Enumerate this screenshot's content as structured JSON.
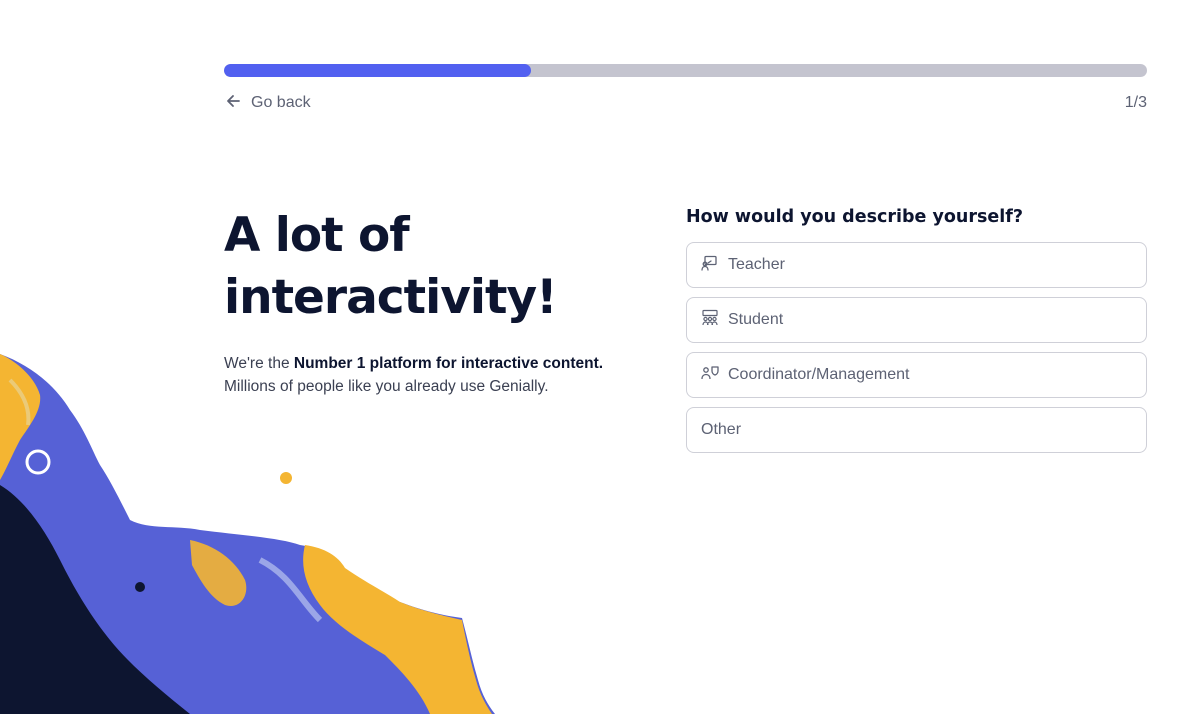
{
  "progress": {
    "fraction": 0.333,
    "step_text": "1/3"
  },
  "nav": {
    "go_back_label": "Go back",
    "back_icon": "arrow-left-icon"
  },
  "hero": {
    "title_line1": "A lot of",
    "title_line2": "interactivity!",
    "description_prefix": "We're the ",
    "description_bold": "Number 1 platform for interactive content.",
    "description_suffix": " Millions of people like you already use Genially."
  },
  "form": {
    "question": "How would you describe yourself?",
    "options": [
      {
        "label": "Teacher",
        "icon": "teacher-icon"
      },
      {
        "label": "Student",
        "icon": "student-icon"
      },
      {
        "label": "Coordinator/Management",
        "icon": "coordinator-icon"
      },
      {
        "label": "Other",
        "icon": ""
      }
    ]
  },
  "colors": {
    "accent": "#5260f0",
    "track": "#c4c4cf",
    "navy": "#0d1530",
    "splash_blue": "#5661d6",
    "splash_yellow": "#f4b532",
    "border": "#cfd0d8"
  }
}
